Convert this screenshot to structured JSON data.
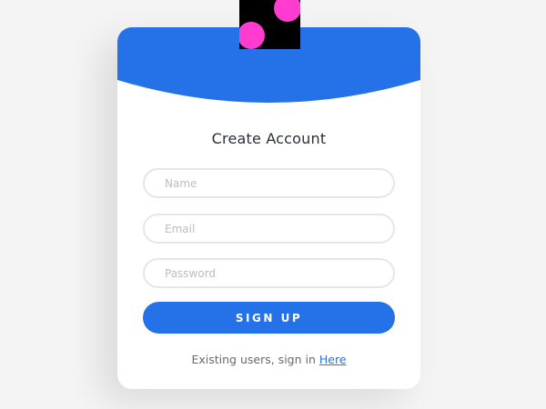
{
  "colors": {
    "page_background": "#f4f4f4",
    "card_background": "#ffffff",
    "accent_blue": "#2471e8",
    "logo_background": "#000000",
    "logo_dots": "#ff3ccf",
    "input_border": "#e6e6e6"
  },
  "form": {
    "title": "Create Account",
    "name_placeholder": "Name",
    "email_placeholder": "Email",
    "password_placeholder": "Password",
    "submit_label": "SIGN UP"
  },
  "footer": {
    "prefix_text": "Existing users, sign in ",
    "link_text": "Here"
  }
}
